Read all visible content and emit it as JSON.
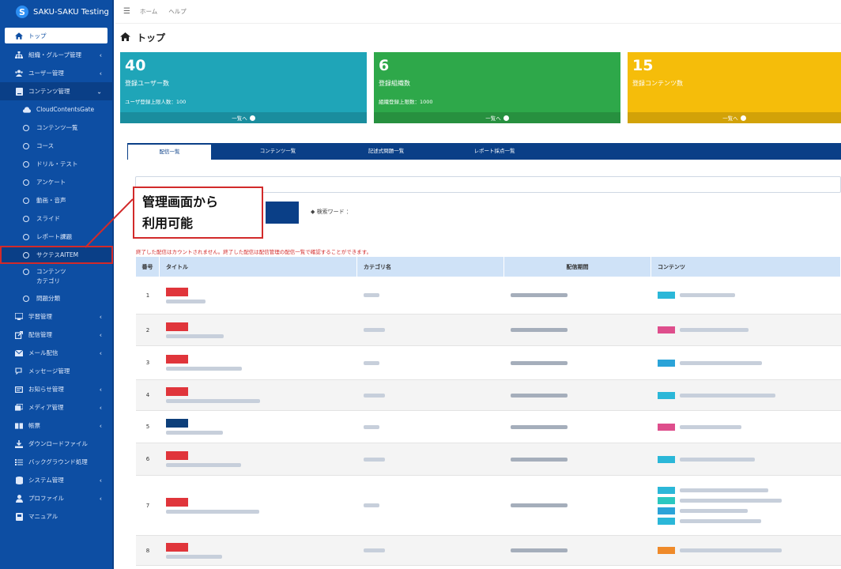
{
  "app": {
    "name": "SAKU-SAKU Testing",
    "logo_letter": "S"
  },
  "sidebar": {
    "items": [
      {
        "label": "トップ",
        "icon": "home-icon",
        "state": "active"
      },
      {
        "label": "組織・グループ管理",
        "icon": "org-icon",
        "chevron": true
      },
      {
        "label": "ユーザー管理",
        "icon": "users-icon",
        "chevron": true
      },
      {
        "label": "コンテンツ管理",
        "icon": "book-icon",
        "chevron": true,
        "state": "open"
      },
      {
        "label": "CloudContentsGate",
        "icon": "cloud-icon",
        "sub": true
      },
      {
        "label": "コンテンツ一覧",
        "icon": "circle-icon",
        "sub": true
      },
      {
        "label": "コース",
        "icon": "circle-icon",
        "sub": true
      },
      {
        "label": "ドリル・テスト",
        "icon": "circle-icon",
        "sub": true
      },
      {
        "label": "アンケート",
        "icon": "circle-icon",
        "sub": true
      },
      {
        "label": "動画・音声",
        "icon": "circle-icon",
        "sub": true
      },
      {
        "label": "スライド",
        "icon": "circle-icon",
        "sub": true
      },
      {
        "label": "レポート課題",
        "icon": "circle-icon",
        "sub": true
      },
      {
        "label": "サクテスAITEM",
        "icon": "circle-icon",
        "sub": true,
        "state": "highlight"
      },
      {
        "label": "コンテンツ\nカテゴリ",
        "icon": "circle-icon",
        "sub": true,
        "tall": true
      },
      {
        "label": "問題分類",
        "icon": "circle-icon",
        "sub": true
      },
      {
        "label": "学習管理",
        "icon": "study-icon",
        "chevron": true
      },
      {
        "label": "配信管理",
        "icon": "share-icon",
        "chevron": true
      },
      {
        "label": "メール配信",
        "icon": "mail-icon",
        "chevron": true
      },
      {
        "label": "メッセージ管理",
        "icon": "chat-icon"
      },
      {
        "label": "お知らせ管理",
        "icon": "notice-icon",
        "chevron": true
      },
      {
        "label": "メディア管理",
        "icon": "media-icon",
        "chevron": true
      },
      {
        "label": "帳票",
        "icon": "report-icon",
        "chevron": true
      },
      {
        "label": "ダウンロードファイル",
        "icon": "download-icon"
      },
      {
        "label": "バックグラウンド処理",
        "icon": "list-icon"
      },
      {
        "label": "システム管理",
        "icon": "database-icon",
        "chevron": true
      },
      {
        "label": "プロファイル",
        "icon": "user-icon",
        "chevron": true
      },
      {
        "label": "マニュアル",
        "icon": "manual-icon"
      }
    ]
  },
  "topbar": {
    "links": [
      "ホーム",
      "ヘルプ"
    ]
  },
  "page": {
    "title": "トップ"
  },
  "cards": [
    {
      "value": "40",
      "label": "登録ユーザー数",
      "sub": "ユーザ登録上限人数：100",
      "link": "一覧へ",
      "color": "#1fa5b8"
    },
    {
      "value": "6",
      "label": "登録組織数",
      "sub": "組織登録上限数：1000",
      "link": "一覧へ",
      "color": "#2ea84a"
    },
    {
      "value": "15",
      "label": "登録コンテンツ数",
      "sub": "",
      "link": "一覧へ",
      "color": "#f5bd0a"
    }
  ],
  "tabs": [
    "配信一覧",
    "コンテンツ一覧",
    "記述式問題一覧",
    "レポート採点一覧"
  ],
  "search": {
    "keyword_label": "◆ 検索ワード ："
  },
  "notice": "終了した配信はカウントされません。終了した配信は配信管理の配信一覧で確認することができます。",
  "table": {
    "headers": [
      "番号",
      "タイトル",
      "カテゴリ名",
      "配信期間",
      "コンテンツ"
    ],
    "rows": [
      {
        "no": "1",
        "badge": "#e0353b",
        "cbadges": [
          "#2bb7d8"
        ]
      },
      {
        "no": "2",
        "badge": "#e0353b",
        "cbadges": [
          "#de4e8c"
        ]
      },
      {
        "no": "3",
        "badge": "#e0353b",
        "cbadges": [
          "#2ba3d8"
        ]
      },
      {
        "no": "4",
        "badge": "#e0353b",
        "cbadges": [
          "#2bb7d8"
        ]
      },
      {
        "no": "5",
        "badge": "#0d3f7a",
        "cbadges": [
          "#de4e8c"
        ]
      },
      {
        "no": "6",
        "badge": "#e0353b",
        "cbadges": [
          "#2bb7d8"
        ]
      },
      {
        "no": "7",
        "badge": "#e0353b",
        "cbadges": [
          "#2bb7d8",
          "#2bc7c0",
          "#2ba3d8",
          "#2bb7d8"
        ]
      },
      {
        "no": "8",
        "badge": "#e0353b",
        "cbadges": [
          "#ef8a2a"
        ]
      }
    ]
  },
  "callout": {
    "line1": "管理画面から",
    "line2": "利用可能"
  },
  "colors": {
    "sidebar": "#0d4ea3",
    "highlight": "#d22a2a",
    "tabbar": "#0a3f87",
    "table_head": "#cfe2f7"
  }
}
